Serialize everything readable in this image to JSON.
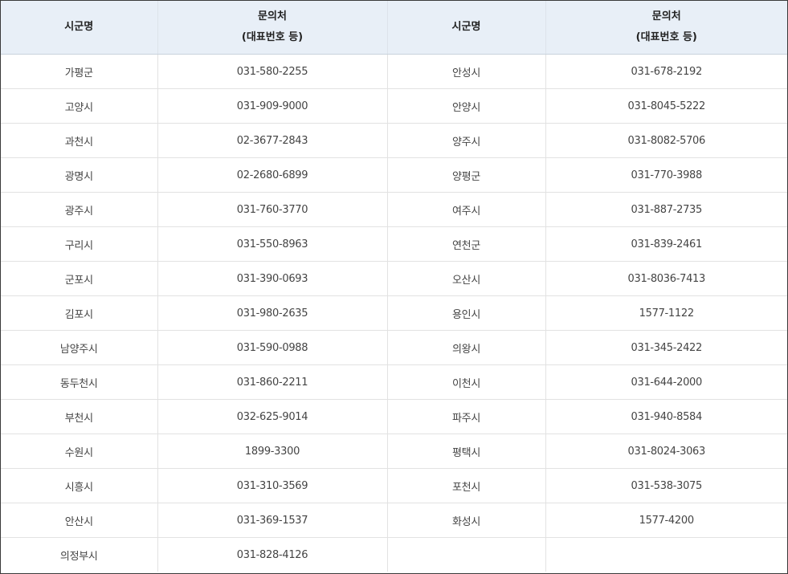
{
  "header": {
    "region": "시군명",
    "contact_line1": "문의처",
    "contact_line2": "(대표번호 등)"
  },
  "rows": [
    {
      "left_name": "가평군",
      "left_phone": "031-580-2255",
      "right_name": "안성시",
      "right_phone": "031-678-2192"
    },
    {
      "left_name": "고양시",
      "left_phone": "031-909-9000",
      "right_name": "안양시",
      "right_phone": "031-8045-5222"
    },
    {
      "left_name": "과천시",
      "left_phone": "02-3677-2843",
      "right_name": "양주시",
      "right_phone": "031-8082-5706"
    },
    {
      "left_name": "광명시",
      "left_phone": "02-2680-6899",
      "right_name": "양평군",
      "right_phone": "031-770-3988"
    },
    {
      "left_name": "광주시",
      "left_phone": "031-760-3770",
      "right_name": "여주시",
      "right_phone": "031-887-2735"
    },
    {
      "left_name": "구리시",
      "left_phone": "031-550-8963",
      "right_name": "연천군",
      "right_phone": "031-839-2461"
    },
    {
      "left_name": "군포시",
      "left_phone": "031-390-0693",
      "right_name": "오산시",
      "right_phone": "031-8036-7413"
    },
    {
      "left_name": "김포시",
      "left_phone": "031-980-2635",
      "right_name": "용인시",
      "right_phone": "1577-1122"
    },
    {
      "left_name": "남양주시",
      "left_phone": "031-590-0988",
      "right_name": "의왕시",
      "right_phone": "031-345-2422"
    },
    {
      "left_name": "동두천시",
      "left_phone": "031-860-2211",
      "right_name": "이천시",
      "right_phone": "031-644-2000"
    },
    {
      "left_name": "부천시",
      "left_phone": "032-625-9014",
      "right_name": "파주시",
      "right_phone": "031-940-8584"
    },
    {
      "left_name": "수원시",
      "left_phone": "1899-3300",
      "right_name": "평택시",
      "right_phone": "031-8024-3063"
    },
    {
      "left_name": "시흥시",
      "left_phone": "031-310-3569",
      "right_name": "포천시",
      "right_phone": "031-538-3075"
    },
    {
      "left_name": "안산시",
      "left_phone": "031-369-1537",
      "right_name": "화성시",
      "right_phone": "1577-4200"
    },
    {
      "left_name": "의정부시",
      "left_phone": "031-828-4126",
      "right_name": "",
      "right_phone": ""
    }
  ]
}
